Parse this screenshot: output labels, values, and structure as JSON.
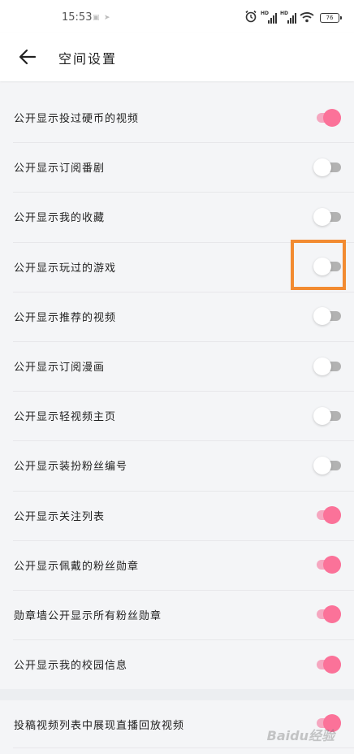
{
  "status_bar": {
    "time": "15:53",
    "signal_label_1": "HD",
    "signal_label_2": "HD",
    "battery": "76"
  },
  "nav": {
    "title": "空间设置"
  },
  "settings": [
    {
      "label": "公开显示投过硬币的视频",
      "enabled": true
    },
    {
      "label": "公开显示订阅番剧",
      "enabled": false
    },
    {
      "label": "公开显示我的收藏",
      "enabled": false
    },
    {
      "label": "公开显示玩过的游戏",
      "enabled": false
    },
    {
      "label": "公开显示推荐的视频",
      "enabled": false
    },
    {
      "label": "公开显示订阅漫画",
      "enabled": false
    },
    {
      "label": "公开显示轻视频主页",
      "enabled": false
    },
    {
      "label": "公开显示装扮粉丝编号",
      "enabled": false
    },
    {
      "label": "公开显示关注列表",
      "enabled": true
    },
    {
      "label": "公开显示佩戴的粉丝勋章",
      "enabled": true
    },
    {
      "label": "勋章墙公开显示所有粉丝勋章",
      "enabled": true
    },
    {
      "label": "公开显示我的校园信息",
      "enabled": true
    }
  ],
  "extra_setting": {
    "label": "投稿视频列表中展现直播回放视频",
    "enabled": true
  },
  "watermark": "Baidu经验",
  "colors": {
    "accent": "#fb7299",
    "accent_track": "#f5a7c0",
    "off_track": "#b2b2b2",
    "highlight": "#f28b31"
  }
}
